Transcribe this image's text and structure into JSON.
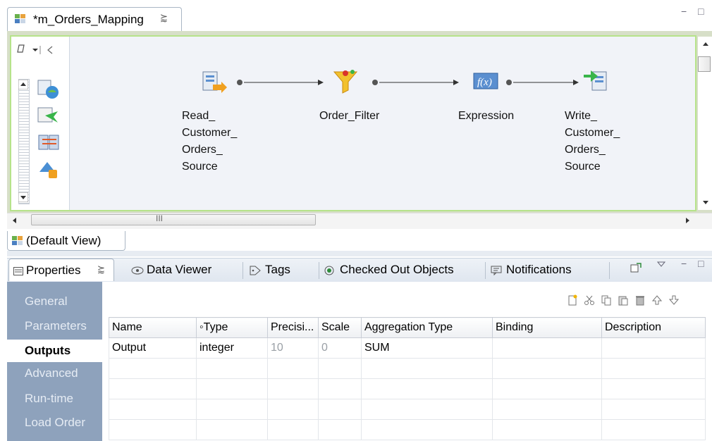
{
  "editor": {
    "tab_title": "*m_Orders_Mapping",
    "tab_close": "⪸",
    "minimize": "−",
    "maximize": "□"
  },
  "mapping": {
    "nodes": [
      {
        "name": "Read_\nCustomer_\nOrders_\nSource",
        "icon": "read-source-icon"
      },
      {
        "name": "Order_Filter",
        "icon": "filter-icon"
      },
      {
        "name": "Expression",
        "icon": "expression-icon"
      },
      {
        "name": "Write_\nCustomer_\nOrders_\nSource",
        "icon": "write-target-icon"
      }
    ],
    "palette_icons": [
      "source-icon",
      "transform-icon",
      "joiner-icon",
      "lookup-icon"
    ]
  },
  "scroll": {
    "thumb_glyph": "III"
  },
  "view": {
    "label": "(Default View)"
  },
  "panel": {
    "tabs": [
      {
        "label": "Properties",
        "icon": "properties-icon",
        "active": true,
        "close": "⪸"
      },
      {
        "label": "Data Viewer",
        "icon": "data-viewer-icon",
        "active": false
      },
      {
        "label": "Tags",
        "icon": "tag-icon",
        "active": false
      },
      {
        "label": "Checked Out Objects",
        "icon": "checked-out-icon",
        "active": false
      },
      {
        "label": "Notifications",
        "icon": "notification-icon",
        "active": false
      }
    ],
    "sidebar": [
      {
        "label": "General",
        "active": false
      },
      {
        "label": "Parameters",
        "active": false
      },
      {
        "label": "Outputs",
        "active": true
      },
      {
        "label": "Advanced",
        "active": false
      },
      {
        "label": "Run-time",
        "active": false
      },
      {
        "label": "Load Order",
        "active": false
      }
    ],
    "toolbar_icons": [
      "new-icon",
      "cut-icon",
      "copy-icon",
      "paste-icon",
      "delete-icon",
      "move-up-icon",
      "move-down-icon"
    ]
  },
  "outputs_table": {
    "columns": [
      "Name",
      "◦Type",
      "Precisi...",
      "Scale",
      "Aggregation Type",
      "Binding",
      "Description"
    ],
    "rows": [
      [
        "Output",
        "integer",
        "10",
        "0",
        "SUM",
        "",
        ""
      ],
      [
        "",
        "",
        "",
        "",
        "",
        "",
        ""
      ],
      [
        "",
        "",
        "",
        "",
        "",
        "",
        ""
      ],
      [
        "",
        "",
        "",
        "",
        "",
        "",
        ""
      ],
      [
        "",
        "",
        "",
        "",
        "",
        "",
        ""
      ]
    ]
  },
  "colors": {
    "sidebar_bg": "#8ea2bc",
    "canvas_border": "#b6e38a",
    "canvas_bg": "#f1f3f8"
  }
}
